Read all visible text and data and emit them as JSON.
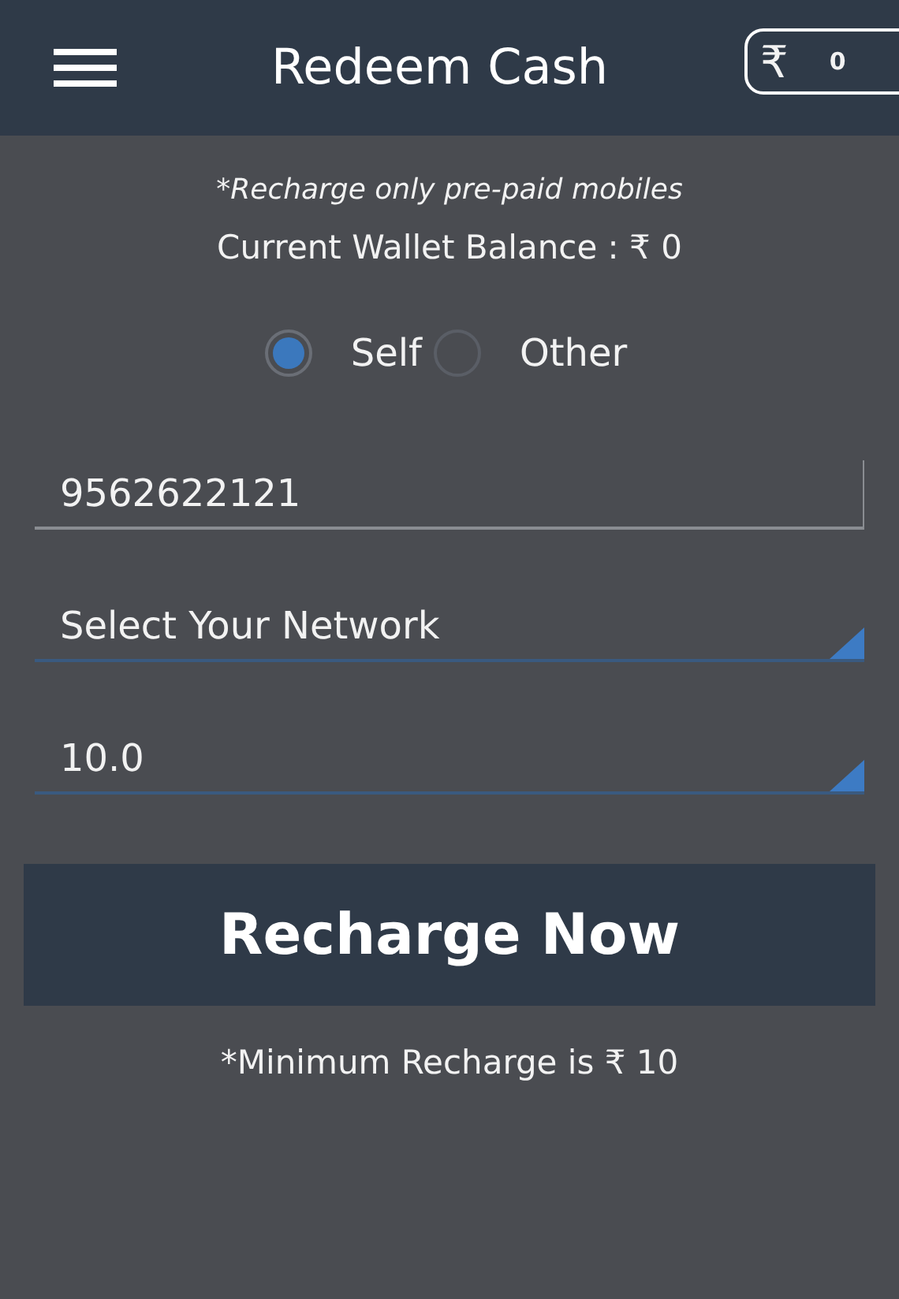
{
  "header": {
    "title": "Redeem Cash",
    "wallet_badge": {
      "currency": "₹",
      "amount": "0"
    }
  },
  "note": "*Recharge only pre-paid mobiles",
  "balance": "Current Wallet Balance : ₹ 0",
  "radios": [
    {
      "label": "Self",
      "selected": true
    },
    {
      "label": "Other",
      "selected": false
    }
  ],
  "fields": [
    {
      "kind": "text",
      "value": "9562622121"
    },
    {
      "kind": "dropdown",
      "value": "Select Your Network"
    },
    {
      "kind": "dropdown",
      "value": "10.0"
    }
  ],
  "button": "Recharge Now",
  "footer_note": "*Minimum Recharge is ₹ 10"
}
